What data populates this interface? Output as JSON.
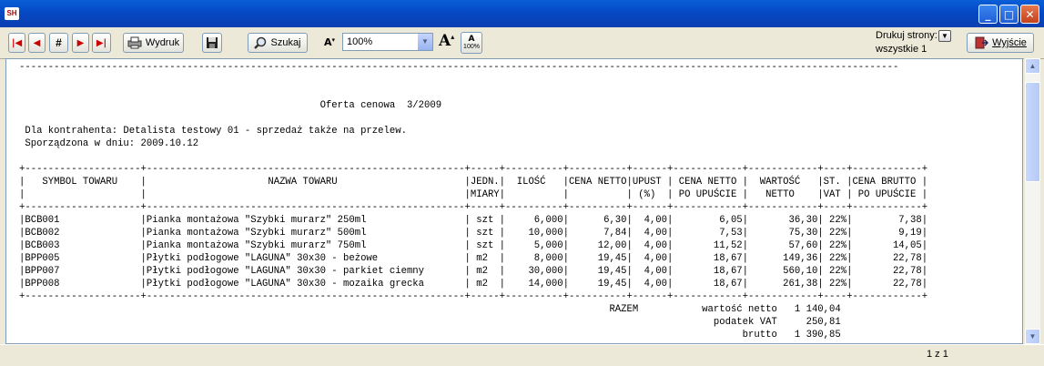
{
  "window": {
    "app_icon": "SH",
    "minimize": "_",
    "maximize": "□",
    "close": "✕"
  },
  "toolbar": {
    "first_icon": "|◀",
    "prev_icon": "◀",
    "goto_icon": "#",
    "next_icon": "▶",
    "last_icon": "▶|",
    "print_label": "Wydruk",
    "search_label": "Szukaj",
    "zoom_value": "100%",
    "zoom_100_label": "100%",
    "print_pages_label": "Drukuj strony:",
    "print_pages_value": "wszystkie 1",
    "exit_label": "Wyjście"
  },
  "report": {
    "title": "Oferta cenowa  3/2009",
    "contractor_line": "Dla kontrahenta: Detalista testowy 01 - sprzedaż także na przelew.",
    "date_line": "Sporządzona w dniu: 2009.10.12",
    "columns": [
      "SYMBOL TOWARU",
      "NAZWA TOWARU",
      "JEDN. MIARY",
      "ILOŚĆ",
      "CENA NETTO",
      "UPUST (%)",
      "CENA NETTO PO UPUŚCIE",
      "WARTOŚĆ NETTO",
      "ST. VAT",
      "CENA BRUTTO PO UPUŚCIE"
    ],
    "rows": [
      {
        "symbol": "BCB001",
        "name": "Pianka montażowa \"Szybki murarz\" 250ml",
        "unit": "szt",
        "qty": "6,000",
        "price": "6,30",
        "disc": "4,00",
        "price_disc": "6,05",
        "value": "36,30",
        "vat": "22%",
        "gross": "7,38"
      },
      {
        "symbol": "BCB002",
        "name": "Pianka montażowa \"Szybki murarz\" 500ml",
        "unit": "szt",
        "qty": "10,000",
        "price": "7,84",
        "disc": "4,00",
        "price_disc": "7,53",
        "value": "75,30",
        "vat": "22%",
        "gross": "9,19"
      },
      {
        "symbol": "BCB003",
        "name": "Pianka montażowa \"Szybki murarz\" 750ml",
        "unit": "szt",
        "qty": "5,000",
        "price": "12,00",
        "disc": "4,00",
        "price_disc": "11,52",
        "value": "57,60",
        "vat": "22%",
        "gross": "14,05"
      },
      {
        "symbol": "BPP005",
        "name": "Płytki podłogowe \"LAGUNA\" 30x30 - beżowe",
        "unit": "m2",
        "qty": "8,000",
        "price": "19,45",
        "disc": "4,00",
        "price_disc": "18,67",
        "value": "149,36",
        "vat": "22%",
        "gross": "22,78"
      },
      {
        "symbol": "BPP007",
        "name": "Płytki podłogowe \"LAGUNA\" 30x30 - parkiet ciemny",
        "unit": "m2",
        "qty": "30,000",
        "price": "19,45",
        "disc": "4,00",
        "price_disc": "18,67",
        "value": "560,10",
        "vat": "22%",
        "gross": "22,78"
      },
      {
        "symbol": "BPP008",
        "name": "Płytki podłogowe \"LAGUNA\" 30x30 - mozaika grecka",
        "unit": "m2",
        "qty": "14,000",
        "price": "19,45",
        "disc": "4,00",
        "price_disc": "18,67",
        "value": "261,38",
        "vat": "22%",
        "gross": "22,78"
      }
    ],
    "totals": {
      "razem": "RAZEM",
      "net_label": "wartość netto",
      "net": "1 140,04",
      "vat_label": "podatek VAT",
      "vat": "250,81",
      "gross_label": "brutto",
      "gross": "1 390,85"
    }
  },
  "status": {
    "pages": "1 z 1"
  }
}
